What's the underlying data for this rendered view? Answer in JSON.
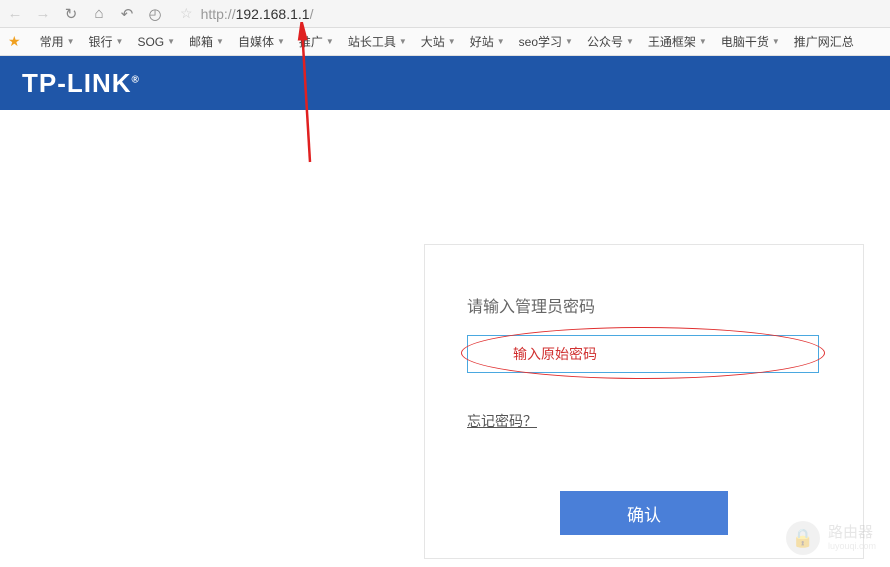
{
  "browser": {
    "url_prefix": "http://",
    "url_host": "192.168.1.1",
    "url_suffix": "/"
  },
  "bookmarks": [
    {
      "label": "常用",
      "dd": true
    },
    {
      "label": "银行",
      "dd": true
    },
    {
      "label": "SOG",
      "dd": true
    },
    {
      "label": "邮箱",
      "dd": true
    },
    {
      "label": "自媒体",
      "dd": true
    },
    {
      "label": "推广",
      "dd": true
    },
    {
      "label": "站长工具",
      "dd": true
    },
    {
      "label": "大站",
      "dd": true
    },
    {
      "label": "好站",
      "dd": true
    },
    {
      "label": "seo学习",
      "dd": true
    },
    {
      "label": "公众号",
      "dd": true
    },
    {
      "label": "王通框架",
      "dd": true
    },
    {
      "label": "电脑干货",
      "dd": true
    },
    {
      "label": "推广网汇总",
      "dd": false
    }
  ],
  "header": {
    "logo": "TP-LINK"
  },
  "login": {
    "title": "请输入管理员密码",
    "placeholder_annot": "输入原始密码",
    "forgot": "忘记密码？",
    "confirm": "确认"
  },
  "watermark": {
    "text": "路由器",
    "sub": "luyouqi.com"
  }
}
